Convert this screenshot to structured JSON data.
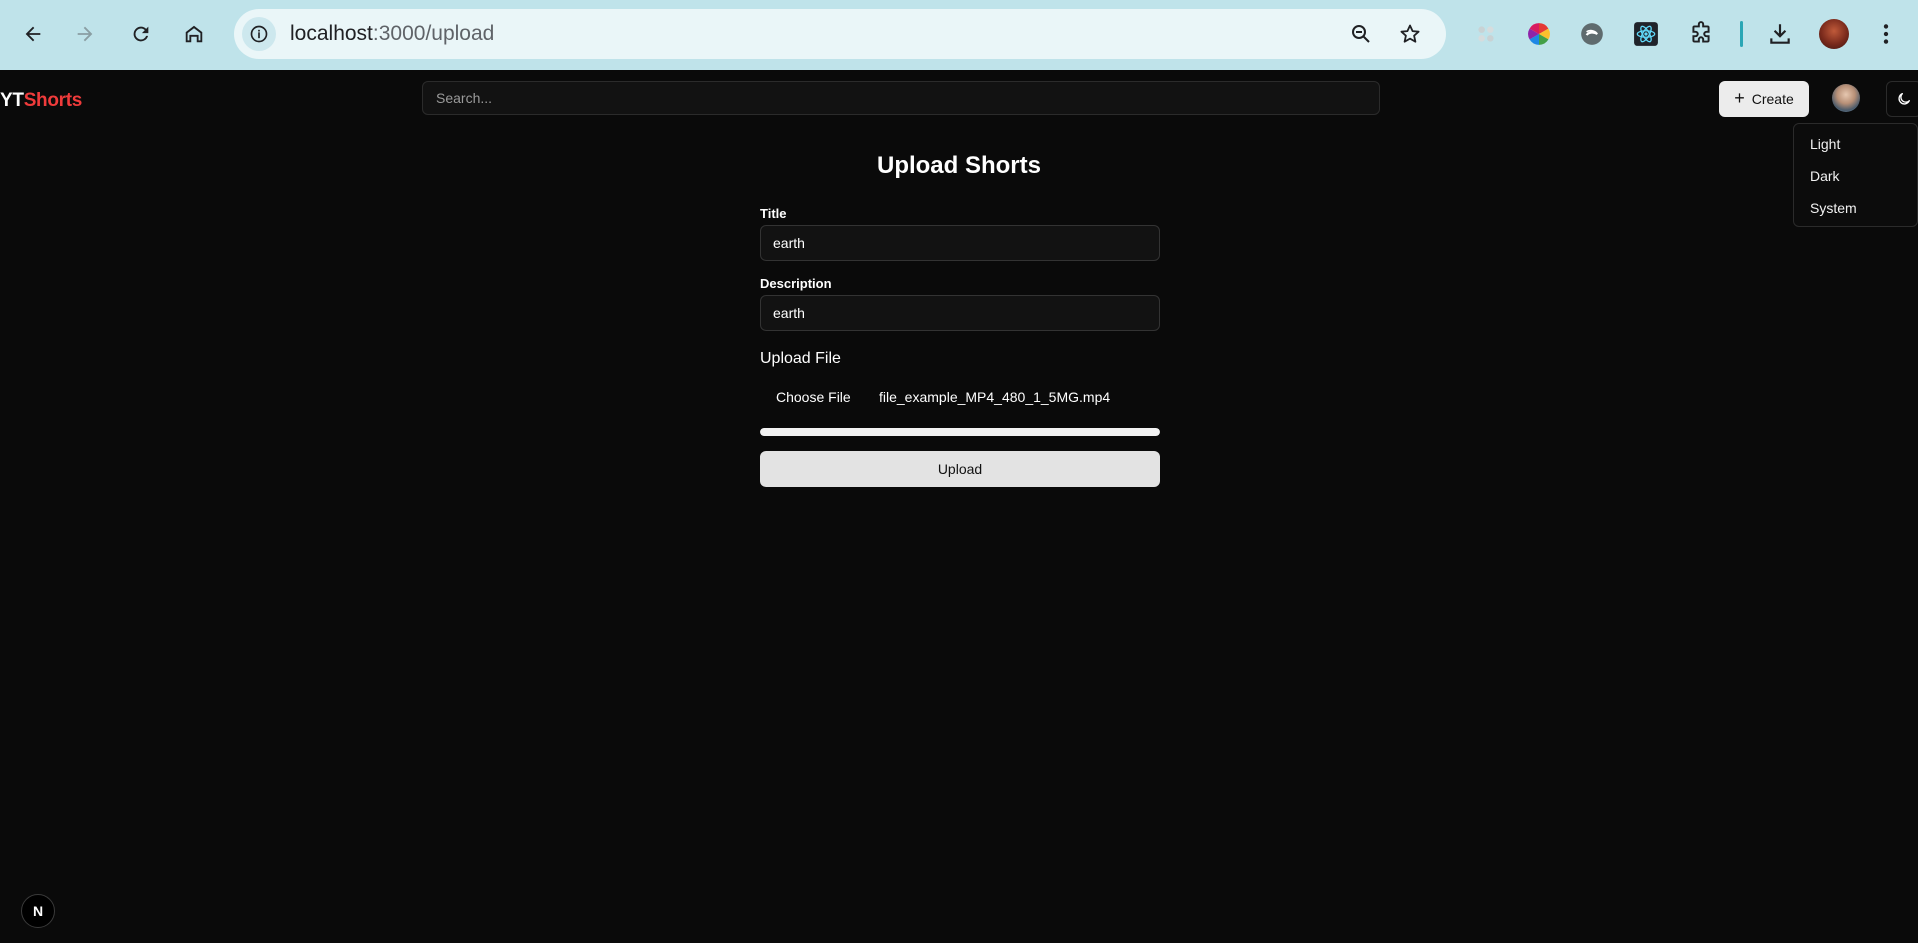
{
  "browser": {
    "url_host": "localhost",
    "url_path": ":3000/upload"
  },
  "header": {
    "logo_yt": "YT",
    "logo_shorts": "Shorts",
    "search_placeholder": "Search...",
    "create_label": "Create"
  },
  "theme_menu": {
    "items": [
      "Light",
      "Dark",
      "System"
    ]
  },
  "form": {
    "title": "Upload Shorts",
    "title_label": "Title",
    "title_value": "earth",
    "description_label": "Description",
    "description_value": "earth",
    "upload_file_label": "Upload File",
    "choose_file_label": "Choose File",
    "file_name": "file_example_MP4_480_1_5MG.mp4",
    "progress": 1.0,
    "upload_label": "Upload"
  },
  "badge": {
    "label": "N"
  },
  "colors": {
    "brand_red": "#ef3b3b",
    "background": "#0a0a0a",
    "chrome": "#bfe3ea"
  }
}
